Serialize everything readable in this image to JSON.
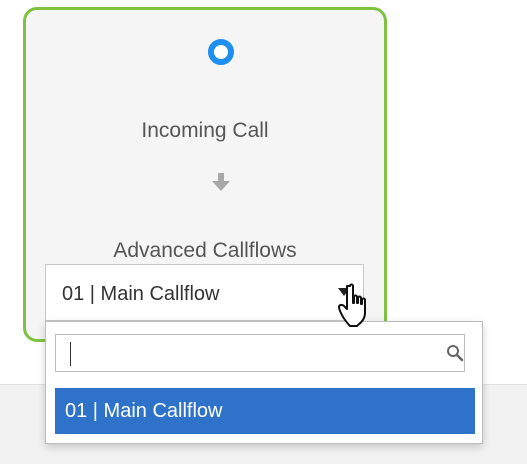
{
  "node": {
    "trigger_label": "Incoming Call",
    "action_label": "Advanced Callflows"
  },
  "dropdown": {
    "selected_value": "01 | Main Callflow",
    "search": {
      "value": "",
      "placeholder": ""
    },
    "options": [
      {
        "label": "01 | Main Callflow",
        "selected": true
      }
    ]
  },
  "icons": {
    "start": "start-node-icon",
    "arrow": "arrow-down-icon",
    "caret": "caret-down-icon",
    "search": "search-icon",
    "pointer": "hand-pointer-icon"
  },
  "colors": {
    "card_border": "#7fc241",
    "start_ring": "#1f8ef1",
    "selected_option_bg": "#2e72c9",
    "selected_option_text": "#ffffff"
  }
}
